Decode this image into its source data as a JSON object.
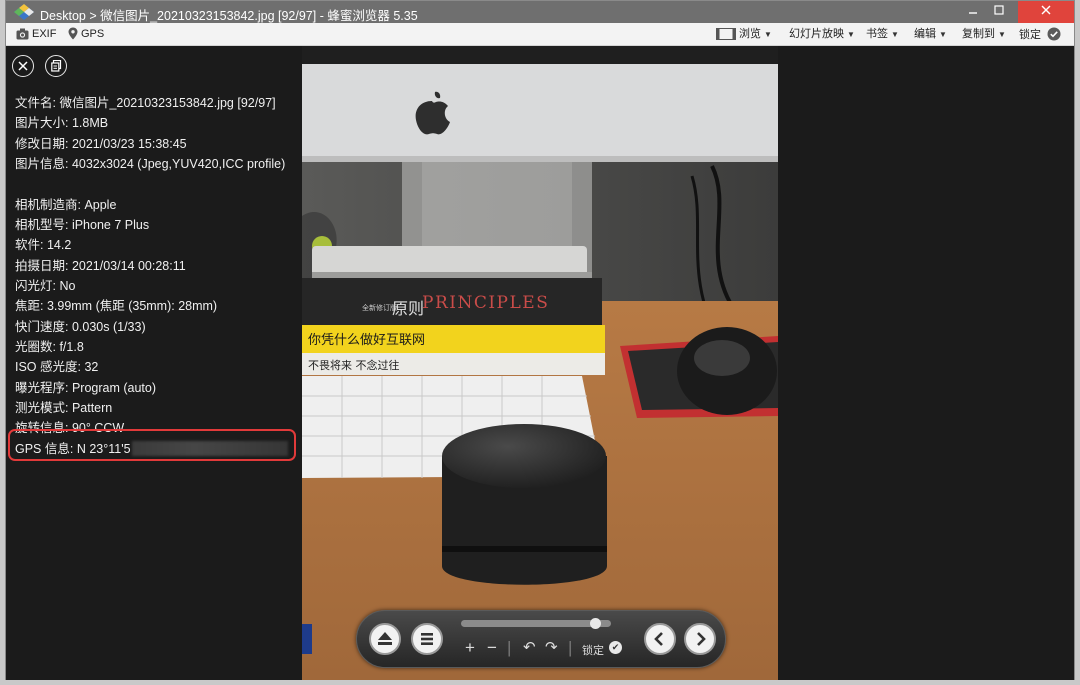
{
  "window": {
    "title": "Desktop > 微信图片_20210323153842.jpg [92/97] - 蜂蜜浏览器 5.35"
  },
  "toolbar": {
    "exif_label": "EXIF",
    "gps_label": "GPS",
    "browse_label": "浏览",
    "slideshow_label": "幻灯片放映",
    "bookmark_label": "书签",
    "edit_label": "编辑",
    "copy_label": "复制到",
    "lock_label": "锁定"
  },
  "info": {
    "filename": "文件名: 微信图片_20210323153842.jpg [92/97]",
    "filesize": "图片大小: 1.8MB",
    "modified": "修改日期: 2021/03/23 15:38:45",
    "imageinfo": "图片信息: 4032x3024 (Jpeg,YUV420,ICC profile)",
    "make": "相机制造商: Apple",
    "model": "相机型号: iPhone 7 Plus",
    "software": "软件: 14.2",
    "shot_date": "拍摄日期: 2021/03/14 00:28:11",
    "flash": "闪光灯: No",
    "focal": "焦距: 3.99mm (焦距 (35mm): 28mm)",
    "shutter": "快门速度: 0.030s (1/33)",
    "aperture": "光圈数: f/1.8",
    "iso": "ISO 感光度: 32",
    "program": "曝光程序: Program (auto)",
    "metering": "测光模式: Pattern",
    "rotation": "旋转信息: 90° CCW",
    "gps": "GPS 信息: N 23°11'5"
  },
  "photo": {
    "book1_latin": "PRINCIPLES",
    "book1_cn": "原则",
    "book1_spine": "全新修订版",
    "book2_cn": "你凭什么做好互联网",
    "book3_cn": "不畏将来 不念过往"
  },
  "navbar": {
    "lock_label": "锁定",
    "zoom_fraction": 0.93
  },
  "colors": {
    "highlight": "#e23a3a",
    "close_button": "#e0443c"
  }
}
